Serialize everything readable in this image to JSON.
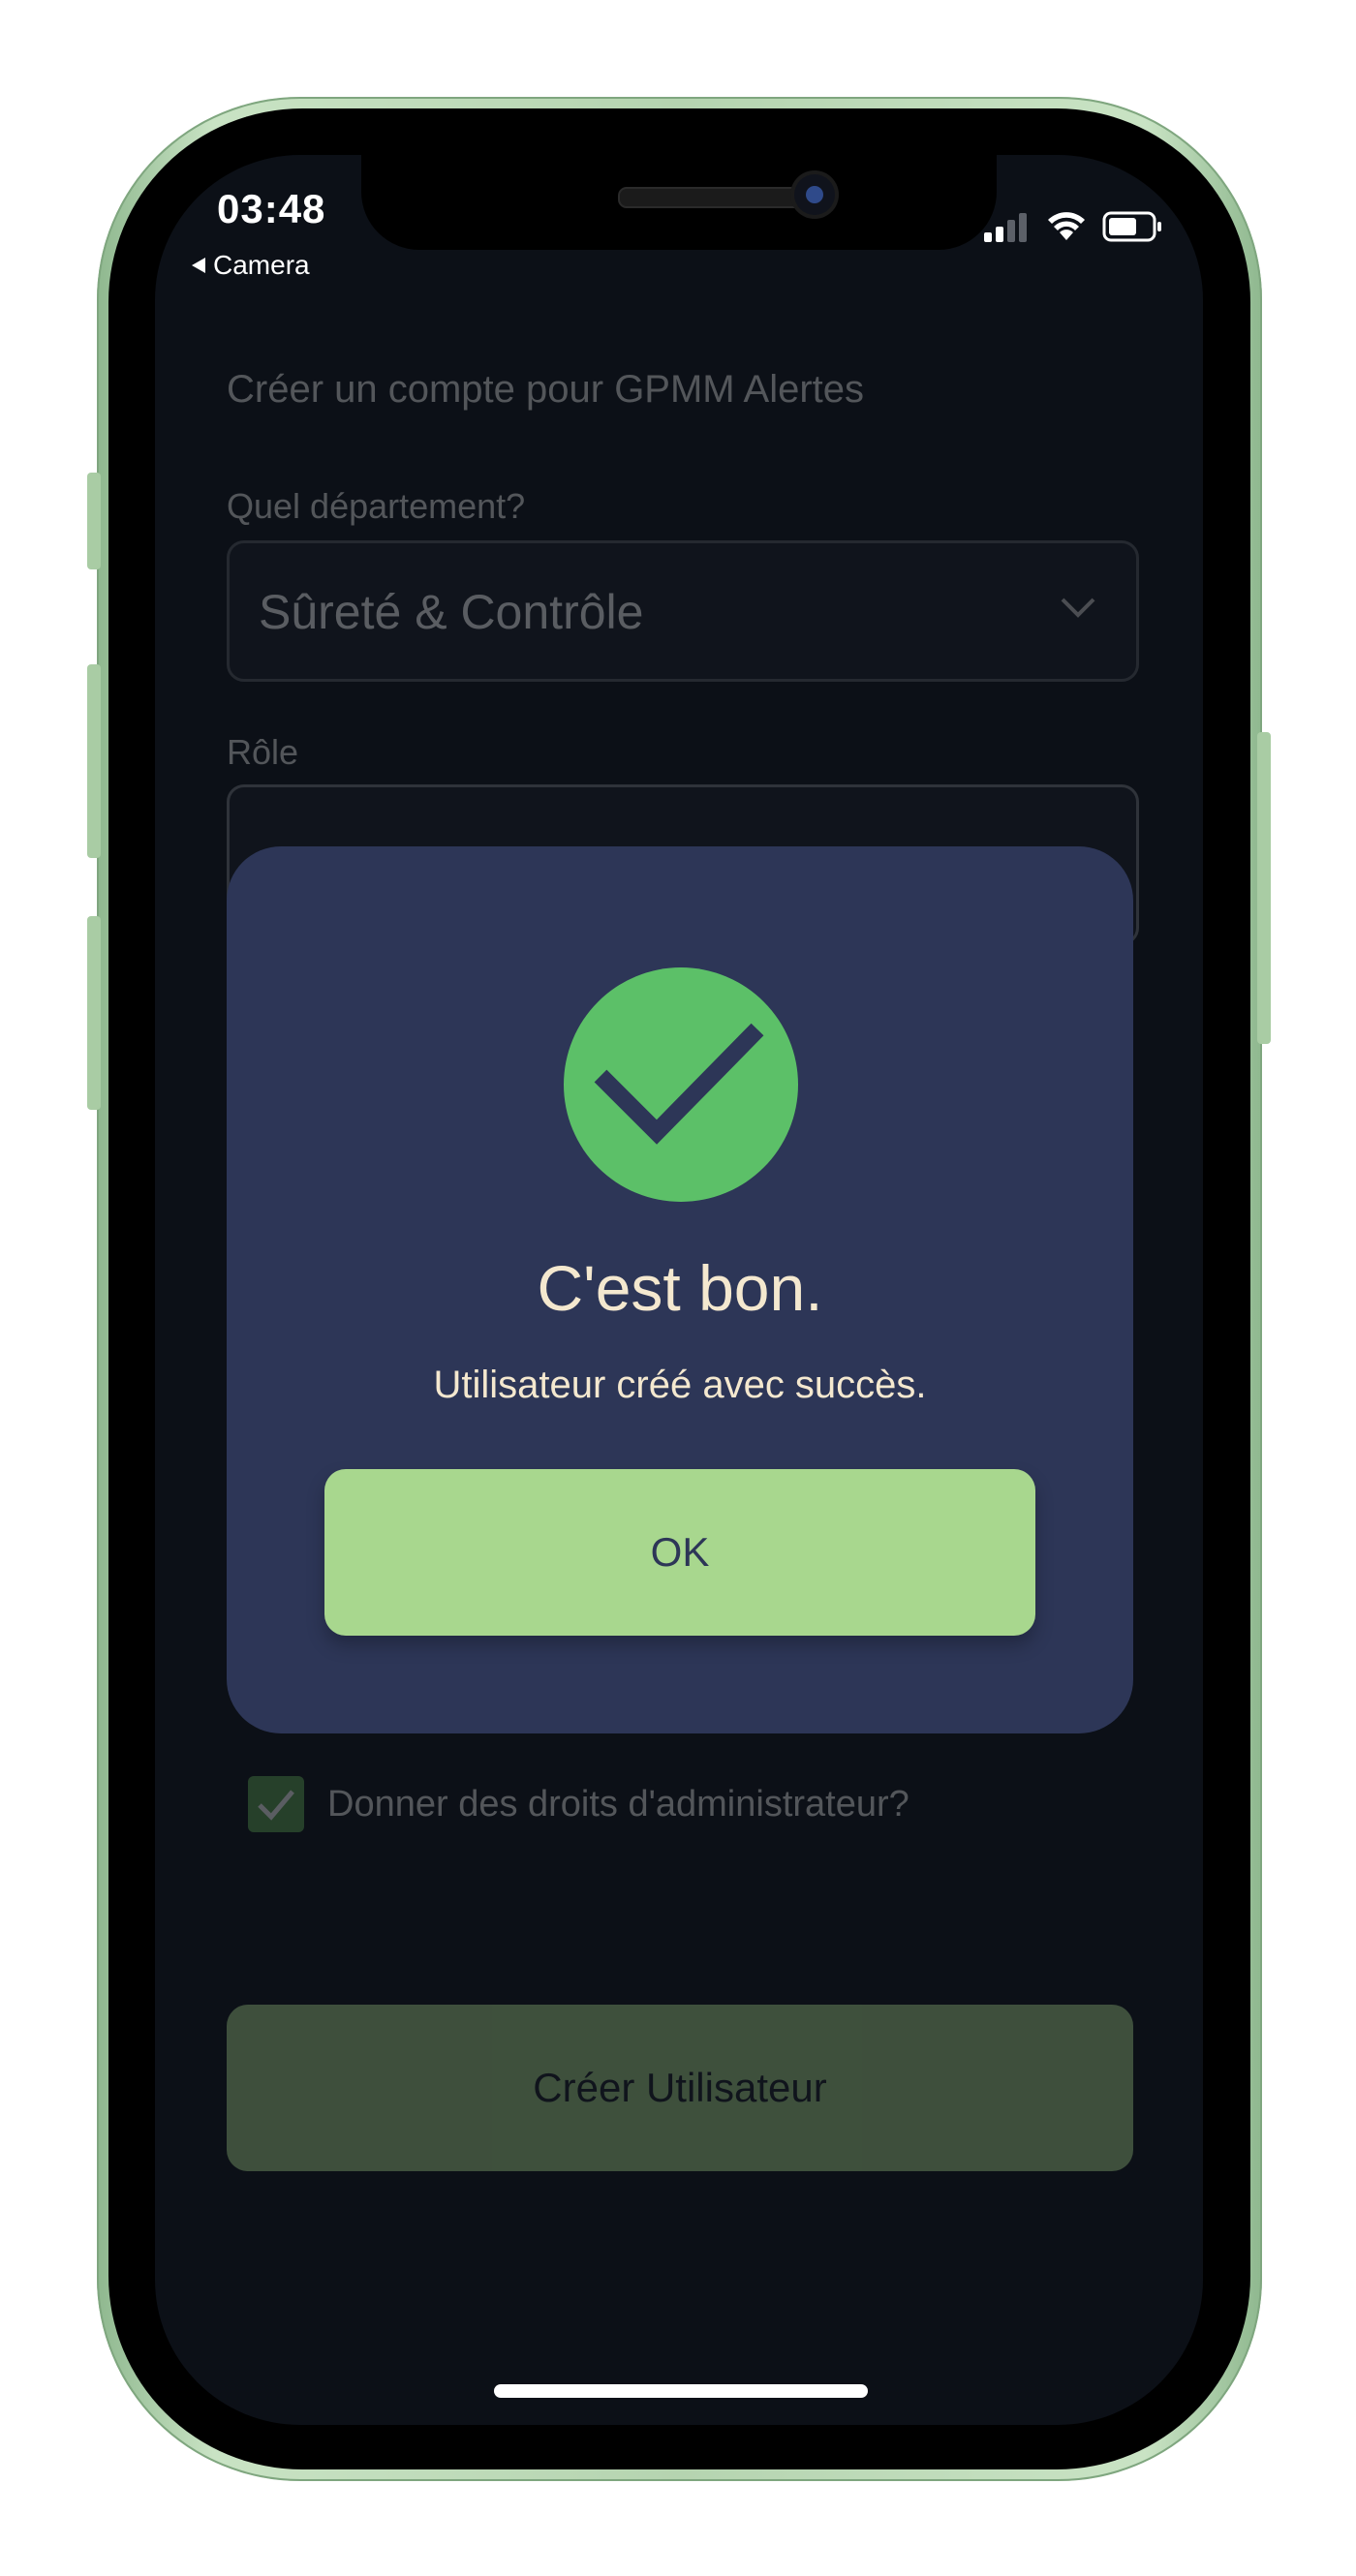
{
  "status_bar": {
    "time": "03:48",
    "back_label": "Camera"
  },
  "form": {
    "title": "Créer un compte pour GPMM Alertes",
    "department_label": "Quel département?",
    "department_value": "Sûreté & Contrôle",
    "role_label": "Rôle",
    "admin_label": "Donner des droits d'administrateur?",
    "admin_checked": true,
    "submit_label": "Créer Utilisateur"
  },
  "modal": {
    "title": "C'est bon.",
    "message": "Utilisateur créé avec succès.",
    "ok_label": "OK"
  },
  "colors": {
    "screen_bg": "#0c1017",
    "modal_bg": "#2d3657",
    "accent_green": "#5cc068",
    "button_green": "#a8d78e",
    "modal_text": "#f4e8cf",
    "frame_green": "#b5d4b0"
  }
}
